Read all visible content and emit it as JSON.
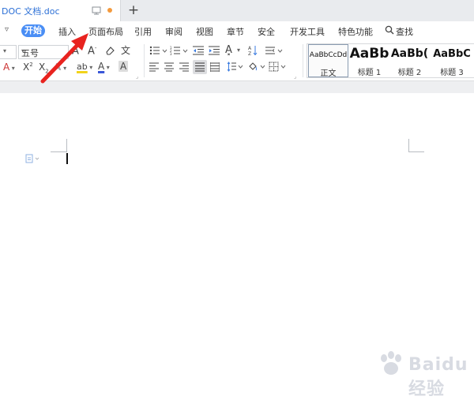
{
  "tab": {
    "title": "DOC 文档.doc",
    "new_tab": "+"
  },
  "menu": {
    "items": [
      "开始",
      "插入",
      "页面布局",
      "引用",
      "审阅",
      "视图",
      "章节",
      "安全",
      "开发工具",
      "特色功能"
    ],
    "search_label": "查找"
  },
  "toolbar": {
    "font_size": "五号",
    "styles": [
      {
        "sample": "AaBbCcDd",
        "name": "正文"
      },
      {
        "sample": "AaBb",
        "name": "标题 1"
      },
      {
        "sample": "AaBb(",
        "name": "标题 2"
      },
      {
        "sample": "AaBbC",
        "name": "标题 3"
      }
    ]
  },
  "watermark": {
    "text": "Baidu经验"
  },
  "colors": {
    "accent": "#4a8ef5",
    "arrow": "#e8231f",
    "tab_title": "#2b6fd6"
  }
}
